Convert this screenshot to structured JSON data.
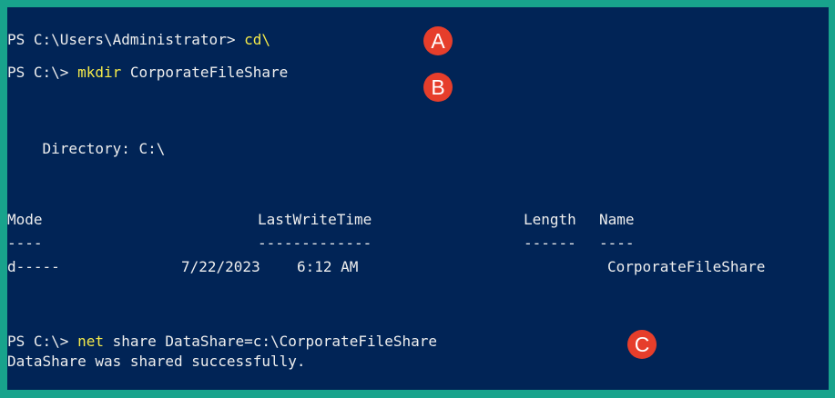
{
  "console": {
    "line1": {
      "prompt": "PS C:\\Users\\Administrator> ",
      "command": "cd\\"
    },
    "line2": {
      "prompt": "PS C:\\> ",
      "command": "mkdir",
      "args": " CorporateFileShare"
    },
    "directory_line": "    Directory: C:\\",
    "headers": {
      "mode": "Mode",
      "lastwritetime": "LastWriteTime",
      "length": "Length",
      "name": "Name"
    },
    "underlines": {
      "mode": "----",
      "lastwritetime": "-------------",
      "length": "------",
      "name": "----"
    },
    "row": {
      "mode": "d-----",
      "date": "7/22/2023",
      "time": "6:12 AM",
      "length": "",
      "name": "CorporateFileShare"
    },
    "line3": {
      "prompt": "PS C:\\> ",
      "command": "net",
      "args": " share DataShare=c:\\CorporateFileShare"
    },
    "output": "DataShare was shared successfully."
  },
  "badges": {
    "a": "A",
    "b": "B",
    "c": "C"
  },
  "colors": {
    "frame": "#18a38c",
    "background": "#012456",
    "text": "#eeeeee",
    "command": "#f4e94a",
    "badge": "#e63e2b"
  }
}
